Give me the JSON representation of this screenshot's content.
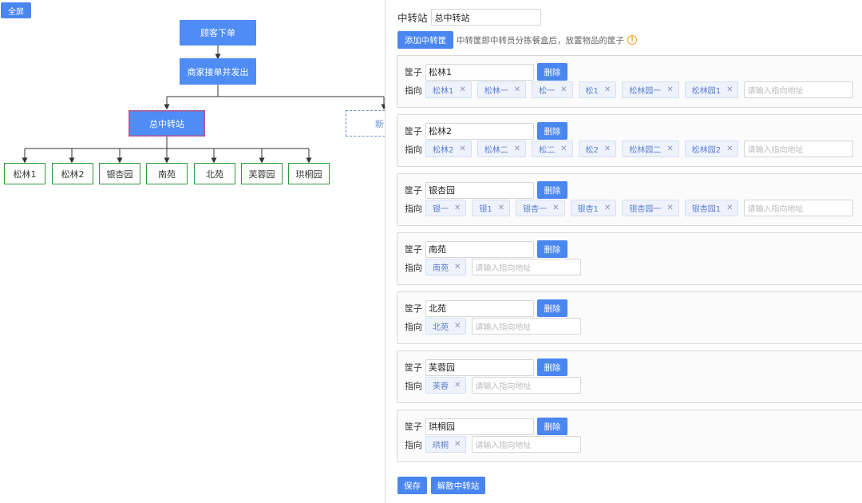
{
  "fullscreen_label": "全屏",
  "flow": {
    "order": "顾客下单",
    "merchant": "商家接单并发出",
    "hub": "总中转站",
    "new": "新",
    "leaves": [
      "松林1",
      "松林2",
      "银杏园",
      "南苑",
      "北苑",
      "芙蓉园",
      "珙桐园"
    ]
  },
  "station": {
    "label": "中转站",
    "value": "总中转站"
  },
  "add_basket": {
    "label": "添加中转筐",
    "hint": "中转筐即中转员分拣餐盒后，放置物品的筐子",
    "icon": "warning-icon"
  },
  "basket_label": "筐子",
  "direction_label": "指向",
  "delete_label": "删除",
  "address_placeholder": "请输入指向地址",
  "baskets": [
    {
      "name": "松林1",
      "tags": [
        "松林1",
        "松林一",
        "松一",
        "松1",
        "松林园一",
        "松林园1"
      ]
    },
    {
      "name": "松林2",
      "tags": [
        "松林2",
        "松林二",
        "松二",
        "松2",
        "松林园二",
        "松林园2"
      ]
    },
    {
      "name": "银杏园",
      "tags": [
        "银一",
        "银1",
        "银杏一",
        "银杏1",
        "银杏园一",
        "银杏园1"
      ]
    },
    {
      "name": "南苑",
      "tags": [
        "南苑"
      ]
    },
    {
      "name": "北苑",
      "tags": [
        "北苑"
      ]
    },
    {
      "name": "芙蓉园",
      "tags": [
        "芙蓉"
      ]
    },
    {
      "name": "珙桐园",
      "tags": [
        "珙桐"
      ]
    }
  ],
  "save_label": "保存",
  "dissolve_label": "解散中转站",
  "colors": {
    "accent": "#4a86f0",
    "leaf_border": "#2f9a3b",
    "hub_dash": "#e0405f"
  }
}
